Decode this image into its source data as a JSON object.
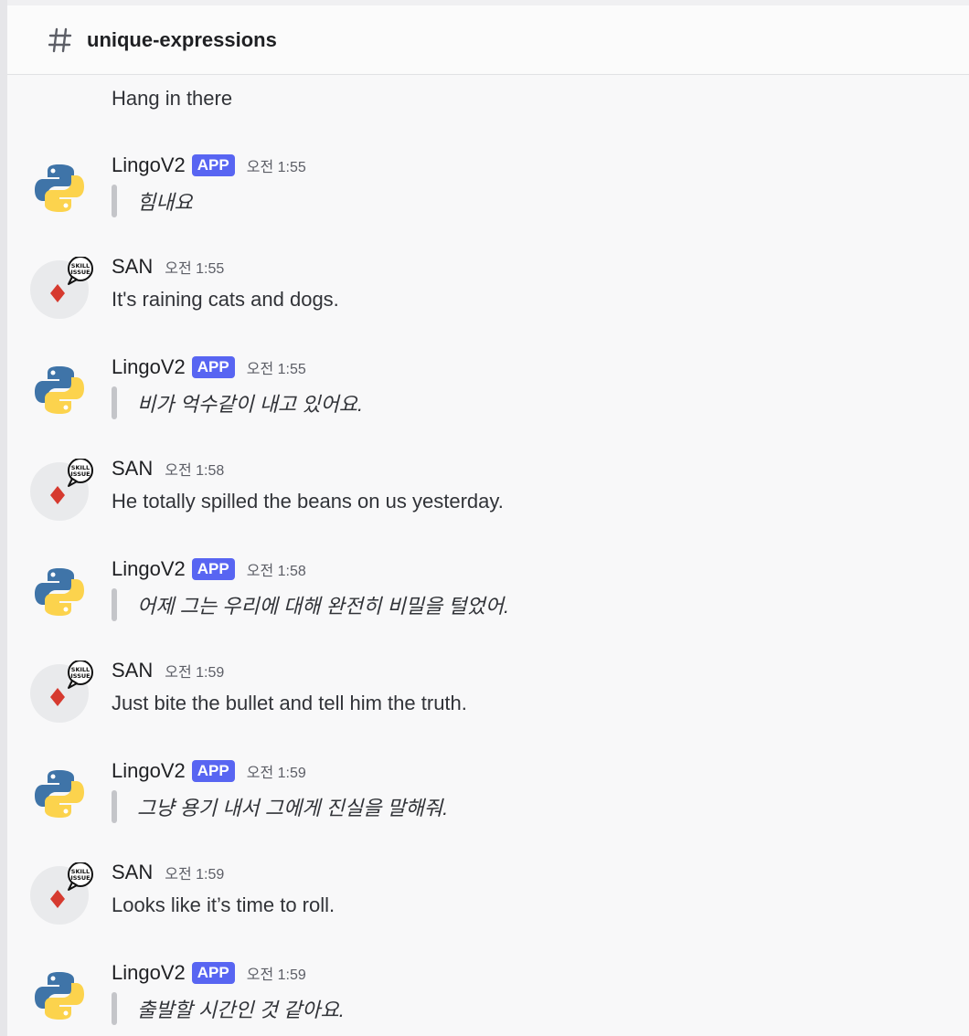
{
  "channel": {
    "name": "unique-expressions"
  },
  "partial_message": {
    "text": "Hang in there"
  },
  "messages": [
    {
      "author": "LingoV2",
      "badge": "APP",
      "time": "오전 1:55",
      "text": "힘내요",
      "type": "bot"
    },
    {
      "author": "SAN",
      "badge": "",
      "time": "오전 1:55",
      "text": "It's raining cats and dogs.",
      "type": "user"
    },
    {
      "author": "LingoV2",
      "badge": "APP",
      "time": "오전 1:55",
      "text": "비가 억수같이 내고 있어요.",
      "type": "bot"
    },
    {
      "author": "SAN",
      "badge": "",
      "time": "오전 1:58",
      "text": "He totally spilled the beans on us yesterday.",
      "type": "user"
    },
    {
      "author": "LingoV2",
      "badge": "APP",
      "time": "오전 1:58",
      "text": "어제 그는 우리에 대해 완전히 비밀을 털었어.",
      "type": "bot"
    },
    {
      "author": "SAN",
      "badge": "",
      "time": "오전 1:59",
      "text": "Just bite the bullet and tell him the truth.",
      "type": "user"
    },
    {
      "author": "LingoV2",
      "badge": "APP",
      "time": "오전 1:59",
      "text": "그냥 용기 내서 그에게 진실을 말해줘.",
      "type": "bot"
    },
    {
      "author": "SAN",
      "badge": "",
      "time": "오전 1:59",
      "text": "Looks like it’s time to roll.",
      "type": "user"
    },
    {
      "author": "LingoV2",
      "badge": "APP",
      "time": "오전 1:59",
      "text": "출발할 시간인 것 같아요.",
      "type": "bot"
    }
  ],
  "avatars": {
    "san_sticker_text": "SKILL ISSUE"
  },
  "colors": {
    "app_badge": "#5865f2",
    "python_blue": "#3f74a8",
    "python_yellow": "#fcd34d",
    "diamond_red": "#d63a2f"
  },
  "icons": {
    "channel": "hash-icon",
    "bot_avatar": "python-logo-icon",
    "user_avatar": "diamond-skill-issue-icon"
  }
}
